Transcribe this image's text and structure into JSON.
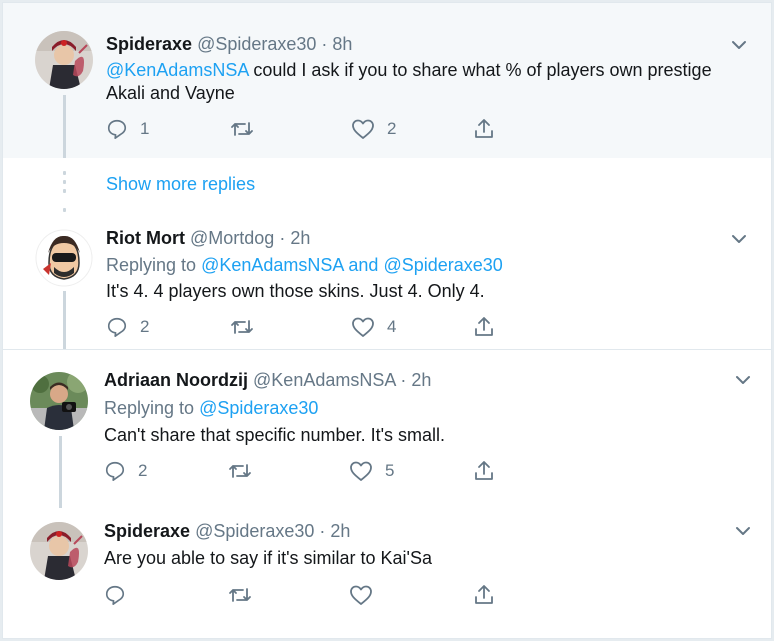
{
  "tweets": [
    {
      "name": "Spideraxe",
      "handle": "@Spideraxe30",
      "sep": " · ",
      "time": "8h",
      "mention": "@KenAdamsNSA",
      "text": " could I ask if you to share what % of players own prestige Akali and Vayne",
      "replies": "1",
      "retweets": "",
      "likes": "2"
    },
    {
      "name": "Riot Mort",
      "handle": "@Mortdog",
      "sep": " · ",
      "time": "2h",
      "replying_label": "Replying to ",
      "replying_a": "@KenAdamsNSA",
      "replying_and": " and ",
      "replying_b": "@Spideraxe30",
      "text": "It's 4. 4 players own those skins. Just 4. Only 4.",
      "replies": "2",
      "retweets": "",
      "likes": "4"
    },
    {
      "name": "Adriaan Noordzij",
      "handle": "@KenAdamsNSA",
      "sep": " · ",
      "time": "2h",
      "replying_label": "Replying to ",
      "replying_a": "@Spideraxe30",
      "text": "Can't share that specific number. It's small.",
      "replies": "2",
      "retweets": "",
      "likes": "5"
    },
    {
      "name": "Spideraxe",
      "handle": "@Spideraxe30",
      "sep": " · ",
      "time": "2h",
      "text": "Are you able to say if it's similar to Kai'Sa",
      "replies": "",
      "retweets": "",
      "likes": ""
    }
  ],
  "show_more": "Show more replies",
  "icons": {
    "reply": "reply-icon",
    "retweet": "retweet-icon",
    "like": "heart-icon",
    "share": "share-icon",
    "caret": "chevron-down-icon"
  },
  "colors": {
    "accent": "#1da1f2",
    "muted": "#657786",
    "highlight_bg": "#f5f8fa"
  }
}
